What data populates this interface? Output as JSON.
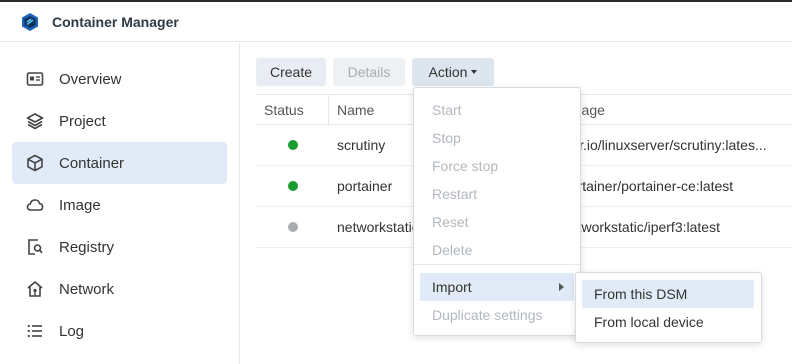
{
  "app": {
    "title": "Container Manager",
    "logo_icon": "container-manager-logo-icon"
  },
  "sidebar": {
    "items": [
      {
        "label": "Overview",
        "icon": "overview-icon",
        "active": false
      },
      {
        "label": "Project",
        "icon": "layers-icon",
        "active": false
      },
      {
        "label": "Container",
        "icon": "cube-icon",
        "active": true
      },
      {
        "label": "Image",
        "icon": "cloud-icon",
        "active": false
      },
      {
        "label": "Registry",
        "icon": "registry-search-icon",
        "active": false
      },
      {
        "label": "Network",
        "icon": "home-network-icon",
        "active": false
      },
      {
        "label": "Log",
        "icon": "list-icon",
        "active": false
      }
    ]
  },
  "toolbar": {
    "create_label": "Create",
    "details_label": "Details",
    "action_label": "Action"
  },
  "table": {
    "columns": {
      "status": "Status",
      "name": "Name",
      "image": "Image"
    },
    "rows": [
      {
        "status_color": "#1a9b2e",
        "name": "scrutiny",
        "image": "lscr.io/linuxserver/scrutiny:lates..."
      },
      {
        "status_color": "#1a9b2e",
        "name": "portainer",
        "image": "portainer/portainer-ce:latest"
      },
      {
        "status_color": "#a8acb1",
        "name": "networkstatic",
        "image": "networkstatic/iperf3:latest"
      }
    ]
  },
  "action_menu": {
    "items": [
      {
        "label": "Start",
        "enabled": false
      },
      {
        "label": "Stop",
        "enabled": false
      },
      {
        "label": "Force stop",
        "enabled": false
      },
      {
        "label": "Restart",
        "enabled": false
      },
      {
        "label": "Reset",
        "enabled": false
      },
      {
        "label": "Delete",
        "enabled": false
      },
      {
        "label": "Import",
        "enabled": true,
        "has_submenu": true
      },
      {
        "label": "Duplicate settings",
        "enabled": false
      }
    ]
  },
  "import_submenu": {
    "items": [
      {
        "label": "From this DSM",
        "highlighted": true
      },
      {
        "label": "From local device",
        "highlighted": false
      }
    ]
  },
  "colors": {
    "accent_bg": "#e1ebf7",
    "running": "#1a9b2e",
    "stopped": "#a8acb1"
  }
}
